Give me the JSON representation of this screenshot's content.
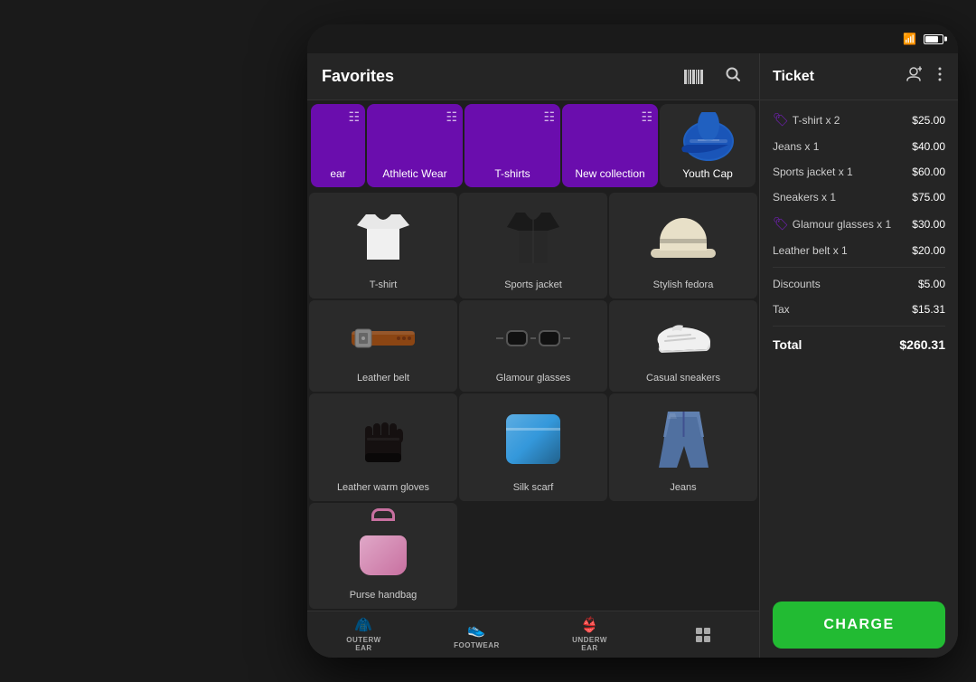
{
  "device": {
    "statusBar": {
      "wifiIcon": "wifi",
      "batteryIcon": "battery"
    }
  },
  "header": {
    "title": "Favorites",
    "barcodeIconAlt": "barcode",
    "searchIconAlt": "search"
  },
  "categories": [
    {
      "id": "outwear-partial",
      "label": "ear",
      "partial": true
    },
    {
      "id": "athletic-wear",
      "label": "Athletic Wear"
    },
    {
      "id": "tshirts",
      "label": "T-shirts"
    },
    {
      "id": "new-collection",
      "label": "New collection"
    },
    {
      "id": "youth-cap",
      "label": "Youth Cap",
      "isImage": true
    }
  ],
  "products": [
    {
      "id": "tshirt",
      "label": "T-shirt",
      "imgType": "tshirt"
    },
    {
      "id": "sports-jacket",
      "label": "Sports jacket",
      "imgType": "jacket"
    },
    {
      "id": "stylish-fedora",
      "label": "Stylish fedora",
      "imgType": "fedora"
    },
    {
      "id": "leather-belt",
      "label": "Leather belt",
      "imgType": "belt"
    },
    {
      "id": "glamour-glasses",
      "label": "Glamour glasses",
      "imgType": "glasses"
    },
    {
      "id": "casual-sneakers",
      "label": "Casual sneakers",
      "imgType": "sneakers"
    },
    {
      "id": "leather-warm-gloves",
      "label": "Leather warm gloves",
      "imgType": "gloves"
    },
    {
      "id": "silk-scarf",
      "label": "Silk scarf",
      "imgType": "scarf"
    },
    {
      "id": "jeans",
      "label": "Jeans",
      "imgType": "jeans"
    },
    {
      "id": "purse-handbag",
      "label": "Purse handbag",
      "imgType": "handbag"
    }
  ],
  "bottomNav": [
    {
      "id": "outerwear",
      "label": "OUTERW EAR"
    },
    {
      "id": "footwear",
      "label": "FOOTWEAR"
    },
    {
      "id": "underwear",
      "label": "UNDERW EAR"
    },
    {
      "id": "grid",
      "label": "",
      "isGrid": true
    }
  ],
  "ticket": {
    "title": "Ticket",
    "addPersonIconAlt": "add-person",
    "moreIconAlt": "more",
    "items": [
      {
        "id": "tshirt",
        "label": "T-shirt  x 2",
        "price": "$25.00",
        "hasDiscount": true
      },
      {
        "id": "jeans",
        "label": "Jeans  x 1",
        "price": "$40.00",
        "hasDiscount": false
      },
      {
        "id": "sports-jacket",
        "label": "Sports jacket  x 1",
        "price": "$60.00",
        "hasDiscount": false
      },
      {
        "id": "sneakers",
        "label": "Sneakers  x 1",
        "price": "$75.00",
        "hasDiscount": false
      },
      {
        "id": "glamour-glasses",
        "label": "Glamour glasses  x 1",
        "price": "$30.00",
        "hasDiscount": true
      },
      {
        "id": "leather-belt",
        "label": "Leather belt  x 1",
        "price": "$20.00",
        "hasDiscount": false
      }
    ],
    "discounts": {
      "label": "Discounts",
      "value": "$5.00"
    },
    "tax": {
      "label": "Tax",
      "value": "$15.31"
    },
    "total": {
      "label": "Total",
      "value": "$260.31"
    },
    "chargeButton": "CHARGE"
  }
}
